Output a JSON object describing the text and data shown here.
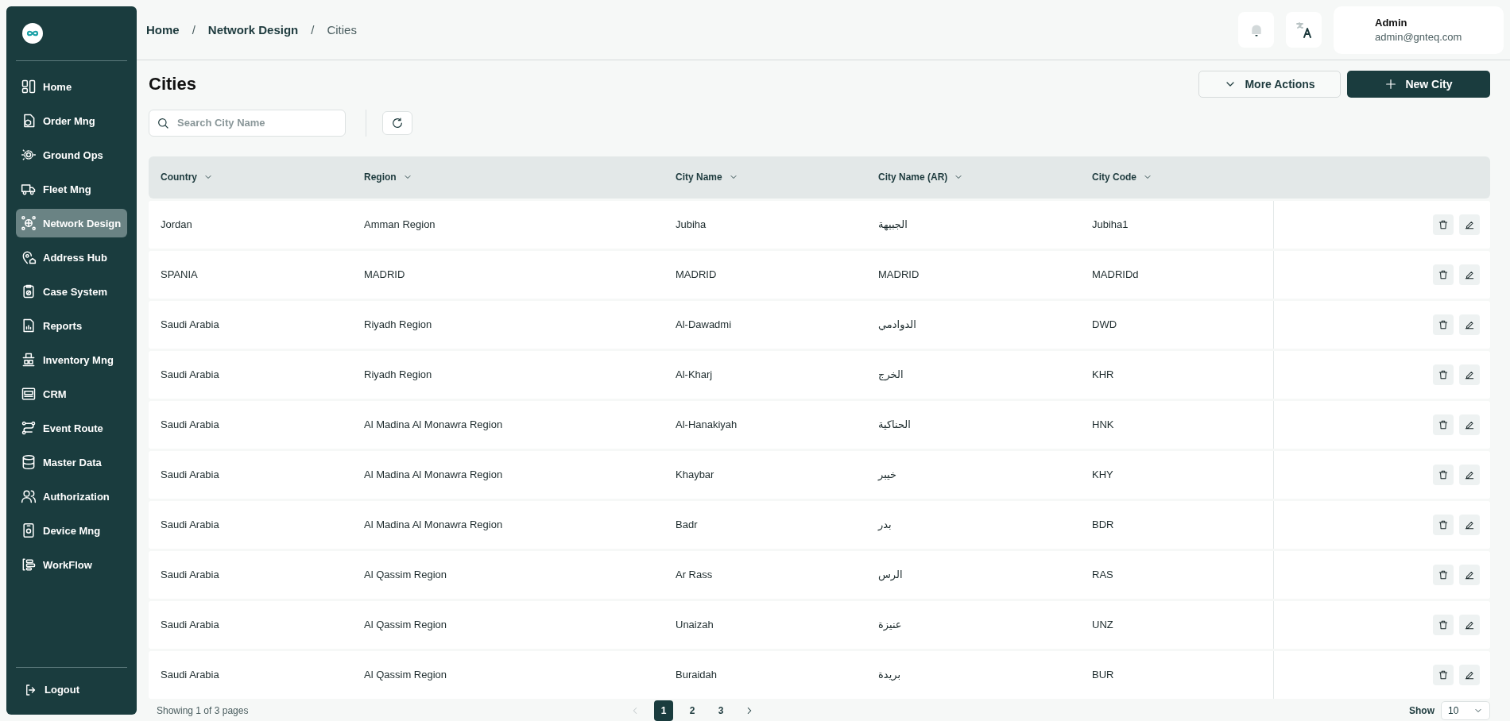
{
  "sidebar": {
    "items": [
      {
        "label": "Home",
        "selected": false
      },
      {
        "label": "Order Mng",
        "selected": false
      },
      {
        "label": "Ground Ops",
        "selected": false
      },
      {
        "label": "Fleet Mng",
        "selected": false
      },
      {
        "label": "Network Design",
        "selected": true
      },
      {
        "label": "Address Hub",
        "selected": false
      },
      {
        "label": "Case System",
        "selected": false
      },
      {
        "label": "Reports",
        "selected": false
      },
      {
        "label": "Inventory Mng",
        "selected": false
      },
      {
        "label": "CRM",
        "selected": false
      },
      {
        "label": "Event Route",
        "selected": false
      },
      {
        "label": "Master Data",
        "selected": false
      },
      {
        "label": "Authorization",
        "selected": false
      },
      {
        "label": "Device Mng",
        "selected": false
      },
      {
        "label": "WorkFlow",
        "selected": false
      }
    ],
    "logout": "Logout"
  },
  "breadcrumb": {
    "items": [
      "Home",
      "Network Design",
      "Cities"
    ],
    "separator": "/"
  },
  "user": {
    "name": "Admin",
    "email": "admin@gnteq.com"
  },
  "page_title": "Cities",
  "actions": {
    "more": "More Actions",
    "new": "New City"
  },
  "search": {
    "placeholder": "Search City Name"
  },
  "table": {
    "columns": [
      "Country",
      "Region",
      "City Name",
      "City Name (AR)",
      "City Code"
    ],
    "rows": [
      [
        "Jordan",
        "Amman Region",
        "Jubiha",
        "الجبيهة",
        "Jubiha1"
      ],
      [
        "SPANIA",
        "MADRID",
        "MADRID",
        "MADRID",
        "MADRIDd"
      ],
      [
        "Saudi Arabia",
        "Riyadh Region",
        "Al-Dawadmi",
        "الدوادمي",
        "DWD"
      ],
      [
        "Saudi Arabia",
        "Riyadh Region",
        "Al-Kharj",
        "الخرج",
        "KHR"
      ],
      [
        "Saudi Arabia",
        "Al Madina Al Monawra Region",
        "Al-Hanakiyah",
        "الحناكية",
        "HNK"
      ],
      [
        "Saudi Arabia",
        "Al Madina Al Monawra Region",
        "Khaybar",
        "خيبر",
        "KHY"
      ],
      [
        "Saudi Arabia",
        "Al Madina Al Monawra Region",
        "Badr",
        "بدر",
        "BDR"
      ],
      [
        "Saudi Arabia",
        "Al Qassim Region",
        "Ar Rass",
        "الرس",
        "RAS"
      ],
      [
        "Saudi Arabia",
        "Al Qassim Region",
        "Unaizah",
        "عنيزة",
        "UNZ"
      ],
      [
        "Saudi Arabia",
        "Al Qassim Region",
        "Buraidah",
        "بريدة",
        "BUR"
      ]
    ]
  },
  "pagination": {
    "summary": "Showing 1 of 3 pages",
    "prev": {
      "disabled": true
    },
    "next": {
      "disabled": false
    },
    "pages": [
      {
        "label": "1",
        "selected": true
      },
      {
        "label": "2",
        "selected": false
      },
      {
        "label": "3",
        "selected": false
      }
    ],
    "show_label": "Show",
    "page_size": "10"
  }
}
